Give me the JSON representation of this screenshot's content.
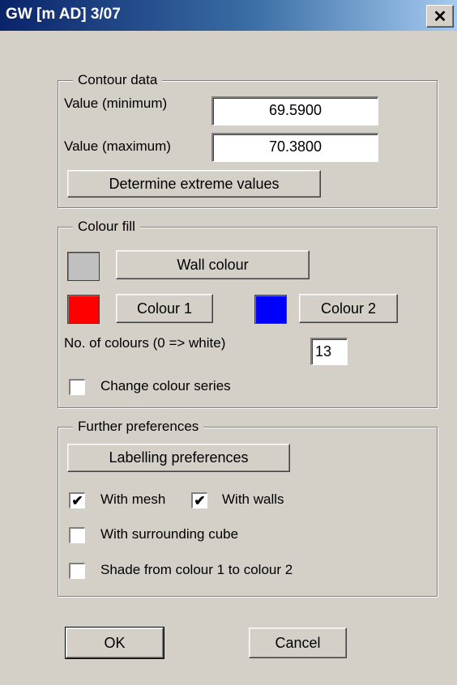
{
  "window": {
    "title": "GW [m AD] 3/07",
    "close_glyph": "✕"
  },
  "contour": {
    "legend": "Contour data",
    "min_label": "Value (minimum)",
    "min_value": "69.5900",
    "max_label": "Value (maximum)",
    "max_value": "70.3800",
    "extreme_button": "Determine extreme values"
  },
  "colour_fill": {
    "legend": "Colour fill",
    "wall_colour_button": "Wall colour",
    "wall_swatch_color": "#c0c0c0",
    "colour1_button": "Colour 1",
    "colour1_swatch_color": "#ff0000",
    "colour2_button": "Colour 2",
    "colour2_swatch_color": "#0000ff",
    "num_colours_label": "No. of colours (0 => white)",
    "num_colours_value": "13",
    "change_series_label": "Change colour series",
    "change_series_checked": false
  },
  "further": {
    "legend": "Further preferences",
    "labelling_button": "Labelling preferences",
    "with_mesh_label": "With mesh",
    "with_mesh_checked": true,
    "with_walls_label": "With walls",
    "with_walls_checked": true,
    "cube_label": "With surrounding cube",
    "cube_checked": false,
    "shade_label": "Shade from colour 1 to colour 2",
    "shade_checked": false
  },
  "footer": {
    "ok": "OK",
    "cancel": "Cancel"
  }
}
